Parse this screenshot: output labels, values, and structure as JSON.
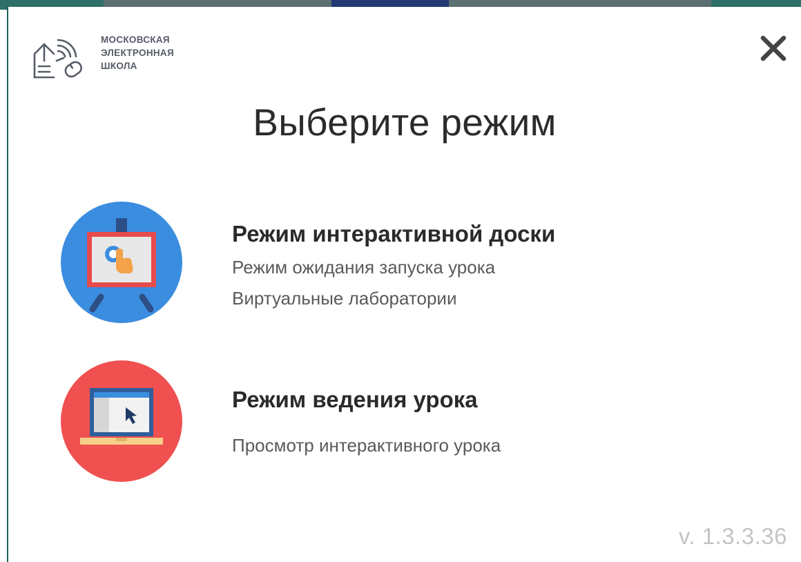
{
  "logo": {
    "line1": "МОСКОВСКАЯ",
    "line2": "ЭЛЕКТРОННАЯ",
    "line3": "ШКОЛА",
    "icon": "mesh-logo-icon"
  },
  "close": {
    "icon": "close-icon"
  },
  "title": "Выберите режим",
  "modes": [
    {
      "title": "Режим интерактивной доски",
      "lines": [
        "Режим ожидания запуска урока",
        "Виртуальные лаборатории"
      ],
      "icon": "interactive-board-icon",
      "color": "#3b8de0"
    },
    {
      "title": "Режим ведения урока",
      "lines": [
        "Просмотр интерактивного урока"
      ],
      "icon": "laptop-lesson-icon",
      "color": "#f05050"
    }
  ],
  "version": "v. 1.3.3.36"
}
